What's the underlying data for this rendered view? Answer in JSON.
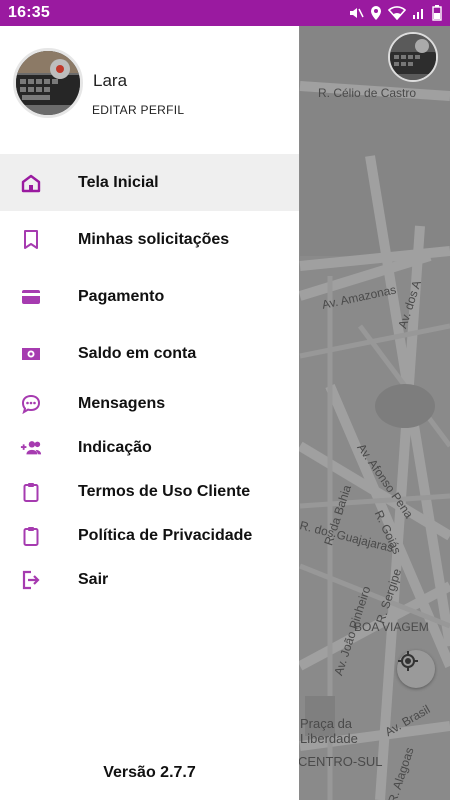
{
  "status_bar": {
    "time": "16:35",
    "icons": [
      "mute-icon",
      "location-icon",
      "wifi-icon",
      "signal-icon",
      "battery-icon"
    ]
  },
  "profile": {
    "name": "Lara",
    "edit_label": "EDITAR PERFIL"
  },
  "menu": {
    "items": [
      {
        "label": "Tela Inicial",
        "icon": "home-icon",
        "active": true
      },
      {
        "label": "Minhas solicitações",
        "icon": "bookmark-icon",
        "active": false
      },
      {
        "label": "Pagamento",
        "icon": "credit-card-icon",
        "active": false
      },
      {
        "label": "Saldo em conta",
        "icon": "money-icon",
        "active": false
      },
      {
        "label": "Mensagens",
        "icon": "chat-bubble-icon",
        "active": false
      },
      {
        "label": "Indicação",
        "icon": "add-group-icon",
        "active": false
      },
      {
        "label": "Termos de Uso Cliente",
        "icon": "clipboard-icon",
        "active": false
      },
      {
        "label": "Política de Privacidade",
        "icon": "clipboard-icon",
        "active": false
      },
      {
        "label": "Sair",
        "icon": "exit-icon",
        "active": false
      }
    ]
  },
  "version": "Versão 2.7.7",
  "map": {
    "labels": {
      "r1": "R. Célio de Castro",
      "r2": "Av. Amazonas",
      "r3": "Av. dos A",
      "r4": "Av. Afonso Pena",
      "r5": "R. da Bahia",
      "r6": "R. Goiás",
      "r7": "R. dos Guajajaras",
      "r8": "R. Sergipe",
      "r9": "Av. João Pinheiro",
      "r10": "BOA VIAGEM",
      "r11": "Praça da Liberdade",
      "r12": "CENTRO-SUL",
      "r13": "Av. Brasil",
      "r14": "R. Alagoas"
    }
  },
  "colors": {
    "accent": "#9a1aa0",
    "icon": "#a63bb0",
    "active_bg": "#efefef",
    "drawer_bg": "#ffffff"
  }
}
